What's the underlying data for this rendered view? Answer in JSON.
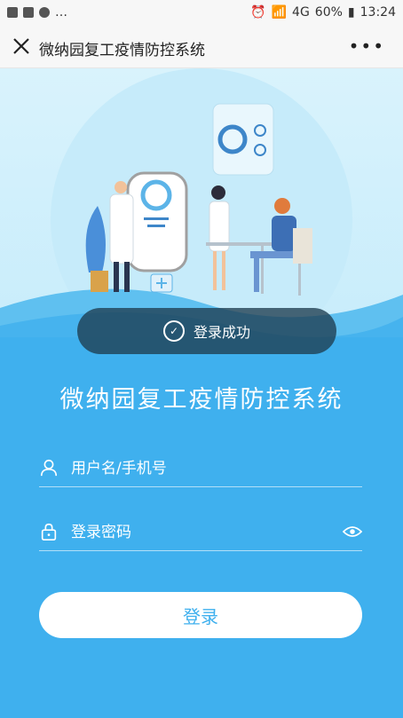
{
  "statusbar": {
    "network": "4G",
    "battery": "60%",
    "time": "13:24",
    "left_icons": [
      "image-icon",
      "folder-icon",
      "sync-icon",
      "more-notifications-icon"
    ]
  },
  "navbar": {
    "title": "微纳园复工疫情防控系统"
  },
  "toast": {
    "text": "登录成功"
  },
  "app": {
    "title": "微纳园复工疫情防控系统"
  },
  "form": {
    "username_placeholder": "用户名/手机号",
    "password_placeholder": "登录密码",
    "login_label": "登录"
  },
  "colors": {
    "primary": "#3fb0ee",
    "hero_bg": "#cfeffc"
  }
}
